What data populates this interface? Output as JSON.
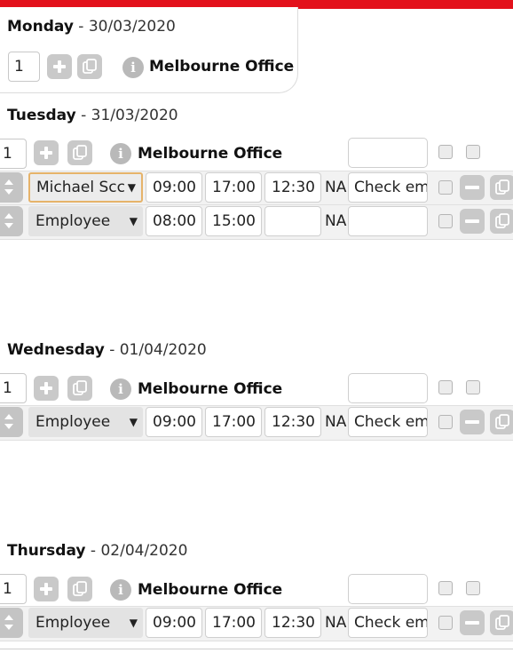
{
  "monday": {
    "day": "Monday",
    "date": " - 30/03/2020",
    "qty": "1",
    "office": "Melbourne Office"
  },
  "tuesday": {
    "day": "Tuesday",
    "date": " - 31/03/2020",
    "qty": "1",
    "office": "Melbourne Office",
    "rows": [
      {
        "employee": "Michael Scc",
        "start": "09:00",
        "end": "17:00",
        "break": "12:30",
        "na": "NA",
        "note": "Check em"
      },
      {
        "employee": "Employee",
        "start": "08:00",
        "end": "15:00",
        "break": "",
        "na": "NA",
        "note": ""
      }
    ]
  },
  "wednesday": {
    "day": "Wednesday",
    "date": " - 01/04/2020",
    "qty": "1",
    "office": "Melbourne Office",
    "rows": [
      {
        "employee": "Employee",
        "start": "09:00",
        "end": "17:00",
        "break": "12:30",
        "na": "NA",
        "note": "Check em"
      }
    ]
  },
  "thursday": {
    "day": "Thursday",
    "date": " - 02/04/2020",
    "qty": "1",
    "office": "Melbourne Office",
    "rows": [
      {
        "employee": "Employee",
        "start": "09:00",
        "end": "17:00",
        "break": "12:30",
        "na": "NA",
        "note": "Check em"
      }
    ]
  },
  "icons": {
    "add": "plus-icon",
    "copy": "copy-icon",
    "info": "info-icon",
    "remove": "minus-icon",
    "sort": "sort-icon",
    "dropdown": "caret-down-icon"
  },
  "info_glyph": "i",
  "caret_glyph": "▼",
  "colors": {
    "brand": "#e3111b",
    "button_gray": "#c9c9c9",
    "focus": "#e6b36a"
  }
}
